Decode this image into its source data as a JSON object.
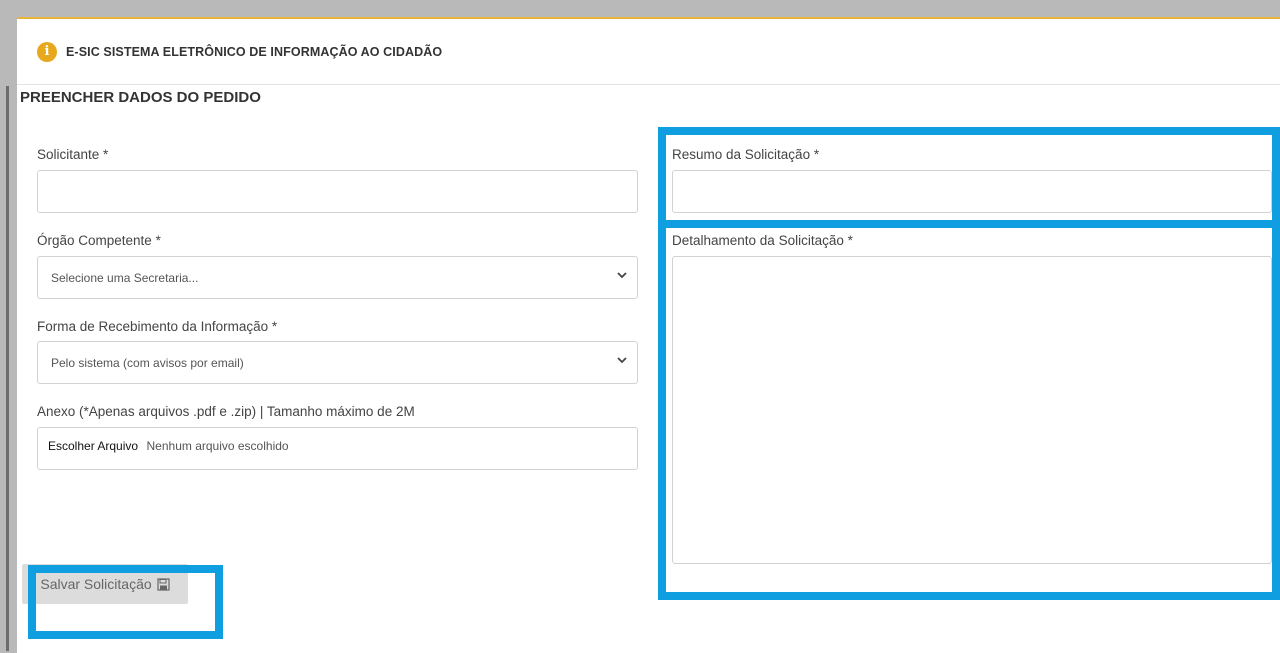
{
  "header": {
    "icon": "info-icon",
    "title": "E-SIC SISTEMA ELETRÔNICO DE INFORMAÇÃO AO CIDADÃO"
  },
  "form": {
    "section_title": "PREENCHER DADOS DO PEDIDO",
    "solicitante": {
      "label": "Solicitante *",
      "value": ""
    },
    "orgao": {
      "label": "Órgão Competente *",
      "selected": "Selecione uma Secretaria..."
    },
    "forma": {
      "label": "Forma de Recebimento da Informação *",
      "selected": "Pelo sistema (com avisos por email)"
    },
    "anexo": {
      "label": "Anexo (*Apenas arquivos .pdf e .zip) | Tamanho máximo de 2M",
      "button": "Escolher Arquivo",
      "status": "Nenhum arquivo escolhido"
    },
    "resumo": {
      "label": "Resumo da Solicitação *",
      "value": ""
    },
    "detalhamento": {
      "label": "Detalhamento da Solicitação *",
      "value": ""
    },
    "save_label": "Salvar Solicitação",
    "save_icon": "floppy-disk-icon"
  },
  "colors": {
    "highlight": "#0f9fe0",
    "accent": "#e7a81e"
  }
}
